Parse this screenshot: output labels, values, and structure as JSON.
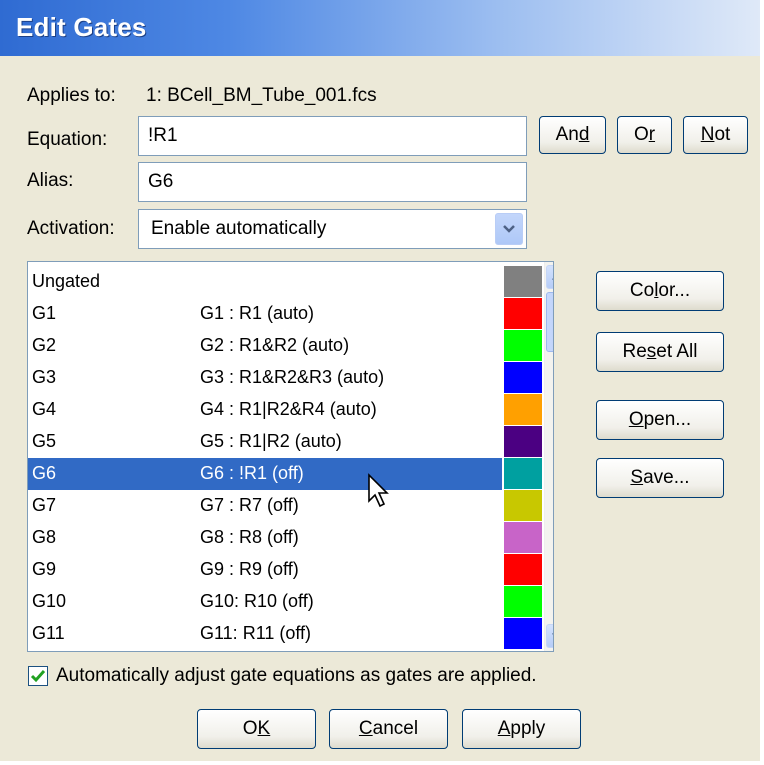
{
  "window": {
    "title": "Edit Gates"
  },
  "applies_to": {
    "label": "Applies to:",
    "value": "1: BCell_BM_Tube_001.fcs"
  },
  "equation": {
    "label": "Equation:",
    "value": "!R1"
  },
  "alias": {
    "label": "Alias:",
    "value": "G6"
  },
  "activation": {
    "label": "Activation:",
    "selected": "Enable automatically"
  },
  "logic_buttons": {
    "and_label": "And",
    "or_label": "Or",
    "not_label": "Not"
  },
  "side_buttons": {
    "color": "Color...",
    "reset_all": "Reset All",
    "open": "Open...",
    "save": "Save..."
  },
  "gates": [
    {
      "name": "Ungated",
      "equation": "",
      "color": "#808080"
    },
    {
      "name": "G1",
      "equation": "G1 : R1  (auto)",
      "color": "#ff0000"
    },
    {
      "name": "G2",
      "equation": "G2 : R1&R2  (auto)",
      "color": "#00ff00"
    },
    {
      "name": "G3",
      "equation": "G3 : R1&R2&R3  (auto)",
      "color": "#0000ff"
    },
    {
      "name": "G4",
      "equation": "G4 : R1|R2&R4  (auto)",
      "color": "#ffa000"
    },
    {
      "name": "G5",
      "equation": "G5 : R1|R2  (auto)",
      "color": "#4b0082"
    },
    {
      "name": "G6",
      "equation": "G6 : !R1  (off)",
      "color": "#00a0a0",
      "selected": true
    },
    {
      "name": "G7",
      "equation": "G7 : R7  (off)",
      "color": "#c8c800"
    },
    {
      "name": "G8",
      "equation": "G8 : R8  (off)",
      "color": "#c864c8"
    },
    {
      "name": "G9",
      "equation": "G9 : R9  (off)",
      "color": "#ff0000"
    },
    {
      "name": "G10",
      "equation": "G10: R10  (off)",
      "color": "#00ff00"
    },
    {
      "name": "G11",
      "equation": "G11: R11  (off)",
      "color": "#0000ff"
    }
  ],
  "auto_adjust": {
    "label": "Automatically adjust gate equations as gates are applied.",
    "checked": true
  },
  "footer": {
    "ok": "OK",
    "cancel": "Cancel",
    "apply": "Apply"
  },
  "colors": {
    "selection": "#316ac5",
    "title_bar": "#2f6bd2",
    "dialog_bg": "#ece9d8"
  }
}
